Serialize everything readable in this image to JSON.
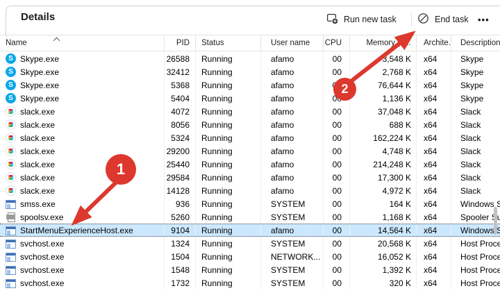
{
  "window": {
    "title": "Details"
  },
  "toolbar": {
    "run_new_task_label": "Run new task",
    "end_task_label": "End task",
    "more_label": "•••"
  },
  "table": {
    "columns": [
      {
        "key": "name",
        "label": "Name"
      },
      {
        "key": "pid",
        "label": "PID"
      },
      {
        "key": "status",
        "label": "Status"
      },
      {
        "key": "user",
        "label": "User name"
      },
      {
        "key": "cpu",
        "label": "CPU"
      },
      {
        "key": "mem",
        "label": "Memory (a..."
      },
      {
        "key": "arch",
        "label": "Archite..."
      },
      {
        "key": "desc",
        "label": "Description"
      }
    ],
    "sort": {
      "column": "name",
      "direction": "ascending"
    },
    "rows": [
      {
        "icon": "skype",
        "name": "Skype.exe",
        "pid": "26588",
        "status": "Running",
        "user": "afamo",
        "cpu": "00",
        "mem": "3,548 K",
        "arch": "x64",
        "desc": "Skype"
      },
      {
        "icon": "skype",
        "name": "Skype.exe",
        "pid": "32412",
        "status": "Running",
        "user": "afamo",
        "cpu": "00",
        "mem": "2,768 K",
        "arch": "x64",
        "desc": "Skype"
      },
      {
        "icon": "skype",
        "name": "Skype.exe",
        "pid": "5368",
        "status": "Running",
        "user": "afamo",
        "cpu": "00",
        "mem": "76,644 K",
        "arch": "x64",
        "desc": "Skype"
      },
      {
        "icon": "skype",
        "name": "Skype.exe",
        "pid": "5404",
        "status": "Running",
        "user": "afamo",
        "cpu": "00",
        "mem": "1,136 K",
        "arch": "x64",
        "desc": "Skype"
      },
      {
        "icon": "slack",
        "name": "slack.exe",
        "pid": "4072",
        "status": "Running",
        "user": "afamo",
        "cpu": "00",
        "mem": "37,048 K",
        "arch": "x64",
        "desc": "Slack"
      },
      {
        "icon": "slack",
        "name": "slack.exe",
        "pid": "8056",
        "status": "Running",
        "user": "afamo",
        "cpu": "00",
        "mem": "688 K",
        "arch": "x64",
        "desc": "Slack"
      },
      {
        "icon": "slack",
        "name": "slack.exe",
        "pid": "5324",
        "status": "Running",
        "user": "afamo",
        "cpu": "00",
        "mem": "162,224 K",
        "arch": "x64",
        "desc": "Slack"
      },
      {
        "icon": "slack",
        "name": "slack.exe",
        "pid": "29200",
        "status": "Running",
        "user": "afamo",
        "cpu": "00",
        "mem": "4,748 K",
        "arch": "x64",
        "desc": "Slack"
      },
      {
        "icon": "slack",
        "name": "slack.exe",
        "pid": "25440",
        "status": "Running",
        "user": "afamo",
        "cpu": "00",
        "mem": "214,248 K",
        "arch": "x64",
        "desc": "Slack"
      },
      {
        "icon": "slack",
        "name": "slack.exe",
        "pid": "29584",
        "status": "Running",
        "user": "afamo",
        "cpu": "00",
        "mem": "17,300 K",
        "arch": "x64",
        "desc": "Slack"
      },
      {
        "icon": "slack",
        "name": "slack.exe",
        "pid": "14128",
        "status": "Running",
        "user": "afamo",
        "cpu": "00",
        "mem": "4,972 K",
        "arch": "x64",
        "desc": "Slack"
      },
      {
        "icon": "winapp",
        "name": "smss.exe",
        "pid": "936",
        "status": "Running",
        "user": "SYSTEM",
        "cpu": "00",
        "mem": "164 K",
        "arch": "x64",
        "desc": "Windows S"
      },
      {
        "icon": "printer",
        "name": "spoolsv.exe",
        "pid": "5260",
        "status": "Running",
        "user": "SYSTEM",
        "cpu": "00",
        "mem": "1,168 K",
        "arch": "x64",
        "desc": "Spooler Su"
      },
      {
        "icon": "winapp",
        "name": "StartMenuExperienceHost.exe",
        "pid": "9104",
        "status": "Running",
        "user": "afamo",
        "cpu": "00",
        "mem": "14,564 K",
        "arch": "x64",
        "desc": "Windows S",
        "selected": true
      },
      {
        "icon": "winapp",
        "name": "svchost.exe",
        "pid": "1324",
        "status": "Running",
        "user": "SYSTEM",
        "cpu": "00",
        "mem": "20,568 K",
        "arch": "x64",
        "desc": "Host Proce"
      },
      {
        "icon": "winapp",
        "name": "svchost.exe",
        "pid": "1504",
        "status": "Running",
        "user": "NETWORK...",
        "cpu": "00",
        "mem": "16,052 K",
        "arch": "x64",
        "desc": "Host Proce"
      },
      {
        "icon": "winapp",
        "name": "svchost.exe",
        "pid": "1548",
        "status": "Running",
        "user": "SYSTEM",
        "cpu": "00",
        "mem": "1,392 K",
        "arch": "x64",
        "desc": "Host Proce"
      },
      {
        "icon": "winapp",
        "name": "svchost.exe",
        "pid": "1732",
        "status": "Running",
        "user": "SYSTEM",
        "cpu": "00",
        "mem": "320 K",
        "arch": "x64",
        "desc": "Host Proce"
      }
    ]
  },
  "annotations": {
    "badge1": "1",
    "badge2": "2"
  },
  "colors": {
    "accent-red": "#dd382e",
    "selection-blue": "#cce8ff",
    "skype-blue": "#0ba7e9",
    "slack-blue": "#36c5f0",
    "slack-green": "#2eb67d",
    "slack-yellow": "#ecb22e",
    "slack-pink": "#e01e5a"
  }
}
